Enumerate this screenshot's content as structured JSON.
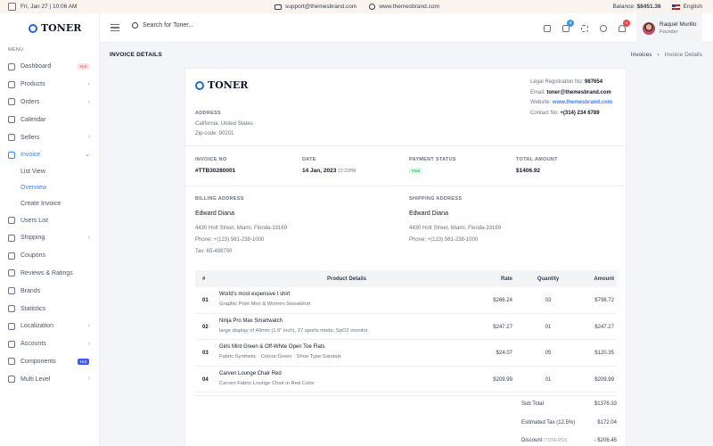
{
  "topbar": {
    "datetime": "Fri, Jan 27 | 10:06 AM",
    "email": "support@themesbrand.com",
    "website": "www.themesbrand.com",
    "balance_label": "Balance:",
    "balance_value": "$8451.36",
    "language": "English"
  },
  "brand": {
    "name": "TONER",
    "accent": "#2166d6"
  },
  "sidebar": {
    "menu_title": "MENU",
    "items": [
      {
        "label": "Dashboard",
        "icon": "dashboard-icon",
        "badge": "Hot"
      },
      {
        "label": "Products",
        "icon": "box-icon",
        "chevron": true
      },
      {
        "label": "Orders",
        "icon": "cart-icon",
        "chevron": true
      },
      {
        "label": "Calendar",
        "icon": "calendar-icon"
      },
      {
        "label": "Sellers",
        "icon": "store-icon",
        "chevron": true
      },
      {
        "label": "Invoice",
        "icon": "file-icon",
        "chevron": true,
        "active": true
      },
      {
        "label": "Users List",
        "icon": "user-icon"
      },
      {
        "label": "Shipping",
        "icon": "truck-icon",
        "chevron": true
      },
      {
        "label": "Coupons",
        "icon": "ticket-icon"
      },
      {
        "label": "Reviews & Ratings",
        "icon": "star-icon"
      },
      {
        "label": "Brands",
        "icon": "grid-icon"
      },
      {
        "label": "Statistics",
        "icon": "chart-icon"
      },
      {
        "label": "Localization",
        "icon": "globe-icon",
        "chevron": true
      },
      {
        "label": "Accounts",
        "icon": "account-icon",
        "chevron": true
      },
      {
        "label": "Components",
        "icon": "layers-icon",
        "badge": "Hot"
      },
      {
        "label": "Multi Level",
        "icon": "share-icon",
        "chevron": true
      }
    ],
    "invoice_sub": [
      "List View",
      "Overview",
      "Create Invoice"
    ]
  },
  "header": {
    "search_placeholder": "Search for Toner...",
    "cart_count": "5",
    "notif_count": "4",
    "user_name": "Raquel Murillo",
    "user_role": "Founder"
  },
  "page": {
    "title": "INVOICE DETAILS",
    "breadcrumb": [
      "Invoices",
      "Invoice Details"
    ]
  },
  "invoice": {
    "address_label": "ADDRESS",
    "address_line": "California, United States",
    "zip": "Zip-code: 90201",
    "legal_label": "Legal Registration No:",
    "legal_value": "987654",
    "email_label": "Email:",
    "email_value": "toner@themesbrand.com",
    "website_label": "Website:",
    "website_value": "www.themesbrand.com",
    "contact_label": "Contact No:",
    "contact_value": "+(314) 234 6789",
    "no_label": "INVOICE NO",
    "no_value": "#TTB30280001",
    "date_label": "DATE",
    "date_value": "14 Jan, 2023",
    "time_value": "12:22PM",
    "status_label": "PAYMENT STATUS",
    "status_value": "Paid",
    "total_label": "TOTAL AMOUNT",
    "total_value": "$1406.92",
    "billing_label": "BILLING ADDRESS",
    "billing_name": "Edward Diana",
    "billing_addr": "4430 Holt Street, Miami, Florida-33169",
    "billing_phone": "Phone: +(123) 561-238-1000",
    "billing_tax": "Tax: 65-498700",
    "shipping_label": "SHIPPING ADDRESS",
    "shipping_name": "Edward Diana",
    "shipping_addr": "4430 Holt Street, Miami, Florida-33169",
    "shipping_phone": "Phone: +(123) 561-238-1000"
  },
  "table": {
    "headers": [
      "#",
      "Product Details",
      "Rate",
      "Quantity",
      "Amount"
    ],
    "rows": [
      {
        "no": "01",
        "name": "World's most expensive t shirt",
        "desc": "Graphic Print Men & Women Sweatshirt",
        "rate": "$266.24",
        "qty": "03",
        "amount": "$798.72"
      },
      {
        "no": "02",
        "name": "Ninja Pro Max Smartwatch",
        "desc": "large display of 40mm (1.6\" inch), 27 sports mode, SpO2 monitor",
        "rate": "$247.27",
        "qty": "01",
        "amount": "$247.27"
      },
      {
        "no": "03",
        "name": "Girls Mint Green & Off-White Open Toe Flats",
        "desc": "Fabric:Synthetic · Colour:Green · Shoe Type:Sandals",
        "rate": "$24.07",
        "qty": "05",
        "amount": "$120.35"
      },
      {
        "no": "04",
        "name": "Carven Lounge Chair Red",
        "desc": "Carven Fabric Lounge Chair in Red Color",
        "rate": "$209.99",
        "qty": "01",
        "amount": "$209.99"
      }
    ]
  },
  "totals": {
    "subtotal_label": "Sub Total",
    "subtotal_value": "$1376.33",
    "tax_label": "Estimated Tax (12.5%)",
    "tax_value": "$172.04",
    "discount_label": "Discount",
    "discount_code": "(TONER50)",
    "discount_value": "- $206.45"
  },
  "colors": {
    "blue": "#3b82f6",
    "hot_red_bg": "#fde2e2",
    "hot_red": "#ef4444",
    "hot_blue_bg": "#3b5bfd",
    "paid_green": "#16a34a"
  }
}
